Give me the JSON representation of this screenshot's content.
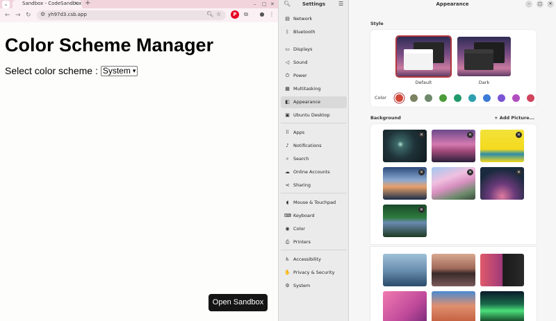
{
  "browser": {
    "tab_title": "Sandbox - CodeSandbox",
    "tab_close_icon": "×",
    "new_tab_icon": "+",
    "url": "yh97d3.csb.app",
    "page": {
      "heading": "Color Scheme Manager",
      "select_label": "Select color scheme :",
      "select_value": "System",
      "open_sandbox_label": "Open Sandbox"
    }
  },
  "settings": {
    "sidebar_title": "Settings",
    "content_title": "Appearance",
    "sidebar_items": [
      {
        "label": "Network",
        "icon": "network-icon"
      },
      {
        "label": "Bluetooth",
        "icon": "bluetooth-icon"
      },
      {
        "label": "Displays",
        "icon": "display-icon"
      },
      {
        "label": "Sound",
        "icon": "sound-icon"
      },
      {
        "label": "Power",
        "icon": "power-icon"
      },
      {
        "label": "Multitasking",
        "icon": "multitasking-icon"
      },
      {
        "label": "Appearance",
        "icon": "appearance-icon",
        "active": true
      },
      {
        "label": "Ubuntu Desktop",
        "icon": "ubuntu-desktop-icon"
      },
      {
        "label": "Apps",
        "icon": "apps-icon"
      },
      {
        "label": "Notifications",
        "icon": "notifications-icon"
      },
      {
        "label": "Search",
        "icon": "search-icon"
      },
      {
        "label": "Online Accounts",
        "icon": "online-accounts-icon"
      },
      {
        "label": "Sharing",
        "icon": "sharing-icon"
      },
      {
        "label": "Mouse & Touchpad",
        "icon": "mouse-icon"
      },
      {
        "label": "Keyboard",
        "icon": "keyboard-icon"
      },
      {
        "label": "Color",
        "icon": "color-icon"
      },
      {
        "label": "Printers",
        "icon": "printer-icon"
      },
      {
        "label": "Accessibility",
        "icon": "accessibility-icon"
      },
      {
        "label": "Privacy & Security",
        "icon": "privacy-icon"
      },
      {
        "label": "System",
        "icon": "system-icon"
      }
    ],
    "style": {
      "title": "Style",
      "options": [
        {
          "label": "Default",
          "selected": true
        },
        {
          "label": "Dark",
          "selected": false
        }
      ],
      "color_label": "Color",
      "accent_colors": [
        "#d24735",
        "#7a8262",
        "#6f8a6b",
        "#4c9c3a",
        "#209a6b",
        "#2e9fae",
        "#3c7bd6",
        "#7a55d4",
        "#b04ec0",
        "#d0445c"
      ],
      "selected_accent": "#d24735"
    },
    "background": {
      "title": "Background",
      "add_label": "Add Picture..."
    }
  }
}
